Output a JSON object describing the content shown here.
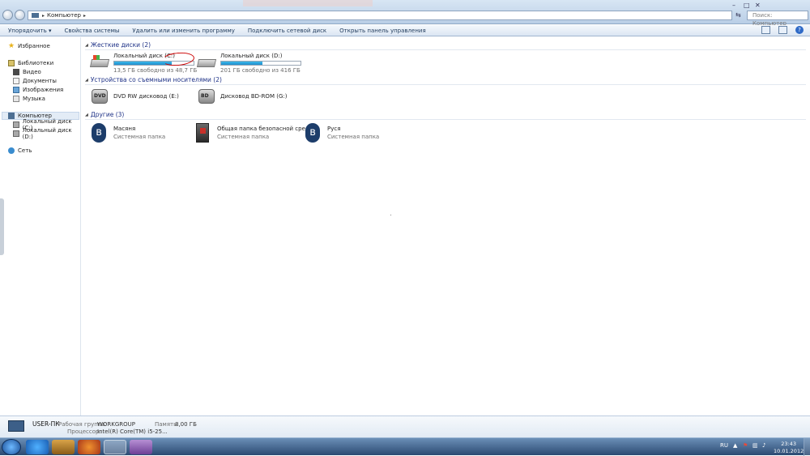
{
  "window": {
    "breadcrumb": "Компьютер",
    "search_placeholder": "Поиск: Компьютер",
    "controls": {
      "minimize": "–",
      "maximize": "□",
      "close": "✕"
    }
  },
  "toolbar": {
    "items": [
      "Упорядочить ▾",
      "Свойства системы",
      "Удалить или изменить программу",
      "Подключить сетевой диск",
      "Открыть панель управления"
    ]
  },
  "nav": {
    "favorites": "Избранное",
    "libraries": "Библиотеки",
    "library_items": [
      "Видео",
      "Документы",
      "Изображения",
      "Музыка"
    ],
    "computer": "Компьютер",
    "computer_items": [
      "Локальный диск (C:)",
      "Локальный диск (D:)"
    ],
    "network": "Сеть"
  },
  "groups": {
    "hard_disks": "Жесткие диски (2)",
    "removable": "Устройства со съемными носителями (2)",
    "other": "Другие (3)"
  },
  "drives": [
    {
      "name": "Локальный диск (C:)",
      "free": "13,5 ГБ свободно из 48,7 ГБ",
      "used_fraction": 0.72
    },
    {
      "name": "Локальный диск (D:)",
      "free": "201 ГБ свободно из 416 ГБ",
      "used_fraction": 0.52
    }
  ],
  "removable": [
    {
      "name": "DVD RW дисковод (E:)",
      "badge": "DVD"
    },
    {
      "name": "Дисковод BD-ROM (G:)",
      "badge": "BD"
    }
  ],
  "other": [
    {
      "name": "Масяня",
      "sub": "Системная папка"
    },
    {
      "name": "Общая папка безопасной среды",
      "sub": "Системная папка"
    },
    {
      "name": "Руся",
      "sub": "Системная папка"
    }
  ],
  "details": {
    "computer_name": "USER-ПК",
    "workgroup_label": "Рабочая группа:",
    "workgroup": "WORKGROUP",
    "memory_label": "Память:",
    "memory": "8,00 ГБ",
    "cpu_label": "Процессор:",
    "cpu": "Intel(R) Core(TM) i5-25..."
  },
  "tray": {
    "lang": "RU",
    "time": "23:43",
    "date": "10.01.2012"
  },
  "colors": {
    "accent": "#1e3287",
    "bar": "#1f8fcd",
    "annotation": "#cc0000"
  }
}
